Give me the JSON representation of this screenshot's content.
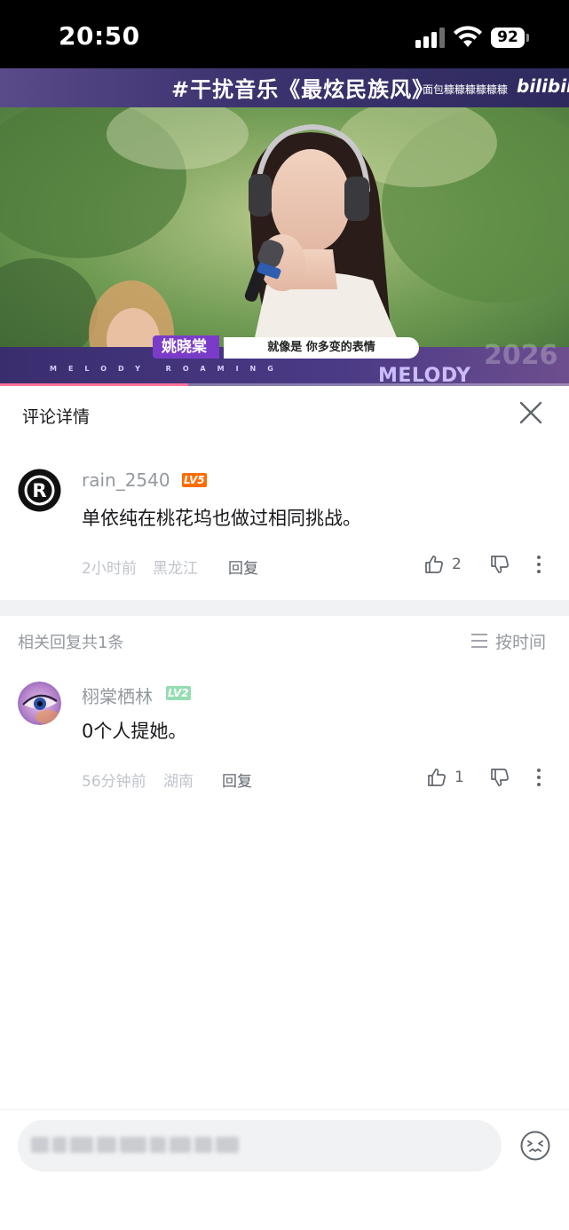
{
  "status_bar": {
    "time": "20:50",
    "battery": "92",
    "signal_bars": 3
  },
  "video": {
    "banner_title": "#干扰音乐《最炫民族风》",
    "uploader": "面包糠糠糠糠糠糠",
    "platform_logo": "bilibili",
    "singer_tag": "姚晓棠",
    "lyric": "就像是 你多变的表情",
    "show_name_small": "MELODY ROAMING",
    "show_name_big": "MELODY ROAMING",
    "year": "2026",
    "progress": 0.33,
    "accent_color": "#fb7299"
  },
  "panel": {
    "title": "评论详情",
    "close_icon": "close-icon"
  },
  "main_comment": {
    "username": "rain_2540",
    "level": "LV5",
    "level_color": "#ff6c00",
    "text": "单依纯在桃花坞也做过相同挑战。",
    "time": "2小时前",
    "location": "黑龙江",
    "reply_label": "回复",
    "likes": "2",
    "avatar_icon": "rust-logo-avatar"
  },
  "related": {
    "count_label": "相关回复共1条",
    "sort_label": "按时间",
    "sort_icon": "menu-icon"
  },
  "reply_comment": {
    "username": "栩棠栖林",
    "level": "LV2",
    "level_color": "#95ddb2",
    "text": "0个人提她。",
    "time": "56分钟前",
    "location": "湖南",
    "reply_label": "回复",
    "likes": "1",
    "avatar_icon": "eye-avatar"
  },
  "input": {
    "placeholder_state": "blurred",
    "emoji_icon": "emoji-icon"
  }
}
